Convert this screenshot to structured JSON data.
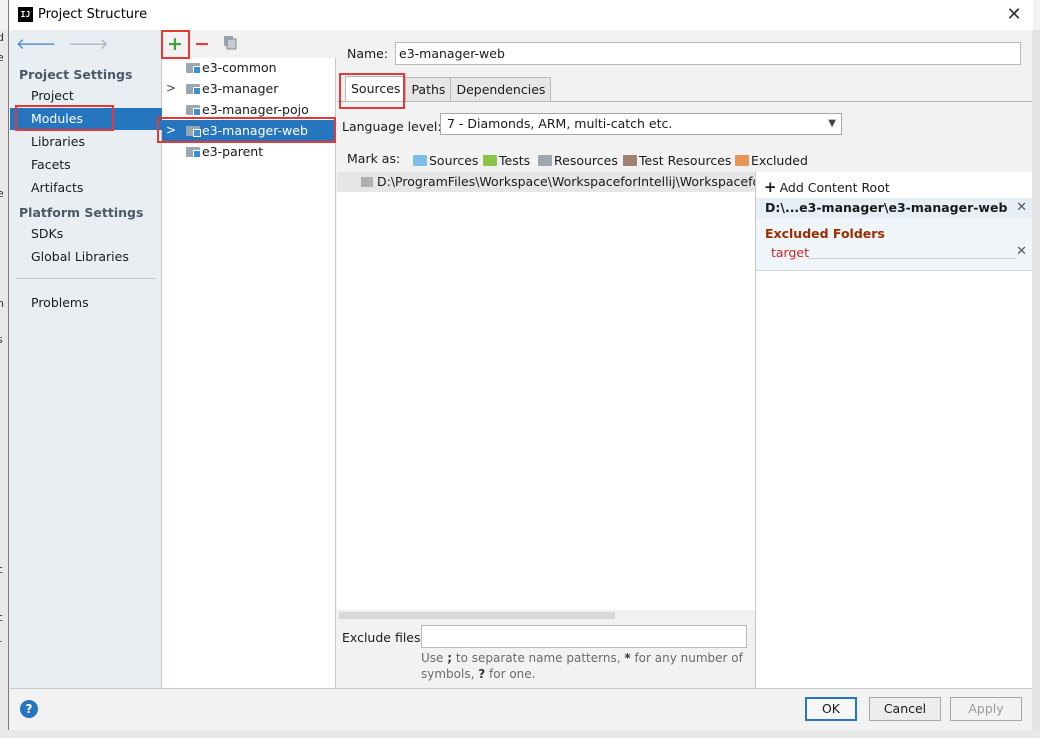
{
  "window": {
    "title": "Project Structure",
    "app_icon_text": "IJ"
  },
  "leftnav": {
    "project_settings_header": "Project Settings",
    "project_items": [
      "Project",
      "Modules",
      "Libraries",
      "Facets",
      "Artifacts"
    ],
    "platform_settings_header": "Platform Settings",
    "platform_items": [
      "SDKs",
      "Global Libraries"
    ],
    "problems": "Problems",
    "selected": "Modules"
  },
  "modules": {
    "toolbar": {
      "add": "+",
      "remove": "−"
    },
    "items": [
      "e3-common",
      "e3-manager",
      "e3-manager-pojo",
      "e3-manager-web",
      "e3-parent"
    ],
    "selected": "e3-manager-web"
  },
  "details": {
    "name_label": "Name:",
    "name_value": "e3-manager-web",
    "tabs": [
      "Sources",
      "Paths",
      "Dependencies"
    ],
    "active_tab": "Sources",
    "language_level_label": "Language level:",
    "language_level_value": "7 - Diamonds, ARM, multi-catch etc.",
    "mark_as_label": "Mark as:",
    "mark_as_items": [
      {
        "label": "Sources",
        "color": "#7dbde8"
      },
      {
        "label": "Tests",
        "color": "#8bc34a"
      },
      {
        "label": "Resources",
        "color": "#9aa7b0"
      },
      {
        "label": "Test Resources",
        "color": "#a08070"
      },
      {
        "label": "Excluded",
        "color": "#e8955a"
      }
    ],
    "root_path": "D:\\ProgramFiles\\Workspace\\WorkspaceforIntellij\\WorkspaceforT",
    "exclude_files_label": "Exclude files:",
    "exclude_files_value": "",
    "hint_part1": "Use ",
    "hint_sep": ";",
    "hint_part2": " to separate name patterns, ",
    "hint_star": "*",
    "hint_part3": " for any number of symbols, ",
    "hint_q": "?",
    "hint_part4": " for one."
  },
  "content_root": {
    "add_label": "Add Content Root",
    "root_name": "D:\\...e3-manager\\e3-manager-web",
    "excluded_header": "Excluded Folders",
    "excluded_items": [
      "target"
    ]
  },
  "buttons": {
    "ok": "OK",
    "cancel": "Cancel",
    "apply": "Apply",
    "help": "?"
  },
  "colors": {
    "accent": "#2675bf",
    "highlight": "#e53935",
    "excluded_header": "#9b2c00"
  }
}
